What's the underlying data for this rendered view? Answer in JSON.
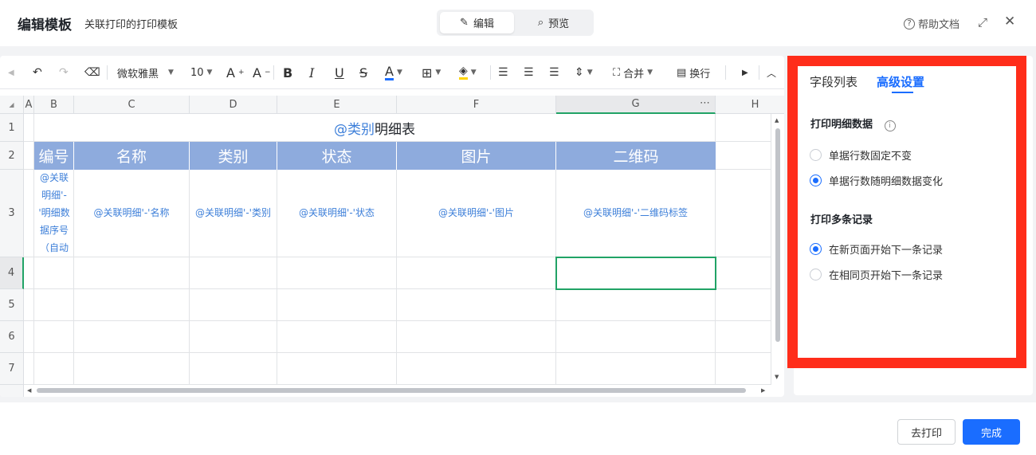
{
  "header": {
    "title": "编辑模板",
    "subtitle": "关联打印的打印模板",
    "modes": {
      "edit": "编辑",
      "preview": "预览"
    },
    "help_label": "帮助文档"
  },
  "toolbar": {
    "font_name": "微软雅黑",
    "font_size": "10",
    "merge_label": "合并",
    "wrap_label": "换行",
    "bold": "B",
    "italic": "I",
    "underline": "U",
    "strike": "S",
    "font_color": "A",
    "font_color_hex": "#1a6dff",
    "fill_color_hex": "#ffd400"
  },
  "columns": [
    "A",
    "B",
    "C",
    "D",
    "E",
    "F",
    "G",
    "H"
  ],
  "rows": [
    "1",
    "2",
    "3",
    "4",
    "5",
    "6",
    "7"
  ],
  "sheet": {
    "title_at": "@类别",
    "title_rest": "明细表",
    "headers": [
      "编号",
      "名称",
      "类别",
      "状态",
      "图片",
      "二维码"
    ],
    "header_bg": "#8eabdd",
    "row3": [
      "@关联明细'-'明细数据序号（自动",
      "@关联明细'-'名称",
      "@关联明细'-'类别",
      "@关联明细'-'状态",
      "@关联明细'-'图片",
      "@关联明细'-'二维码标签"
    ],
    "selected_cell": "G4",
    "accent": "#21a366"
  },
  "panel": {
    "tab_fields": "字段列表",
    "tab_advanced": "高级设置",
    "section1": "打印明细数据",
    "opt1a": "单据行数固定不变",
    "opt1b": "单据行数随明细数据变化",
    "section2": "打印多条记录",
    "opt2a": "在新页面开始下一条记录",
    "opt2b": "在相同页开始下一条记录",
    "selected": [
      "单据行数随明细数据变化",
      "在新页面开始下一条记录"
    ],
    "highlight_color": "#ff2d1a"
  },
  "footer": {
    "print_label": "去打印",
    "done_label": "完成"
  }
}
